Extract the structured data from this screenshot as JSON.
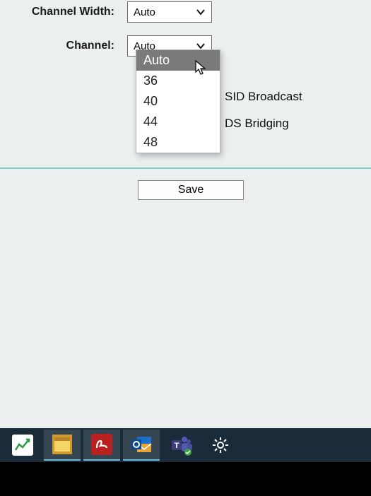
{
  "form": {
    "channelWidth": {
      "label": "Channel Width:",
      "value": "Auto"
    },
    "channel": {
      "label": "Channel:",
      "value": "Auto"
    },
    "channelOptions": [
      "Auto",
      "36",
      "40",
      "44",
      "48"
    ],
    "highlightedOption": "Auto",
    "sideText1": "SID Broadcast",
    "sideText2": "DS Bridging",
    "saveLabel": "Save"
  },
  "taskbar": {
    "icons": [
      "stocks",
      "sticky-notes",
      "adobe-reader",
      "outlook",
      "teams",
      "settings"
    ]
  }
}
